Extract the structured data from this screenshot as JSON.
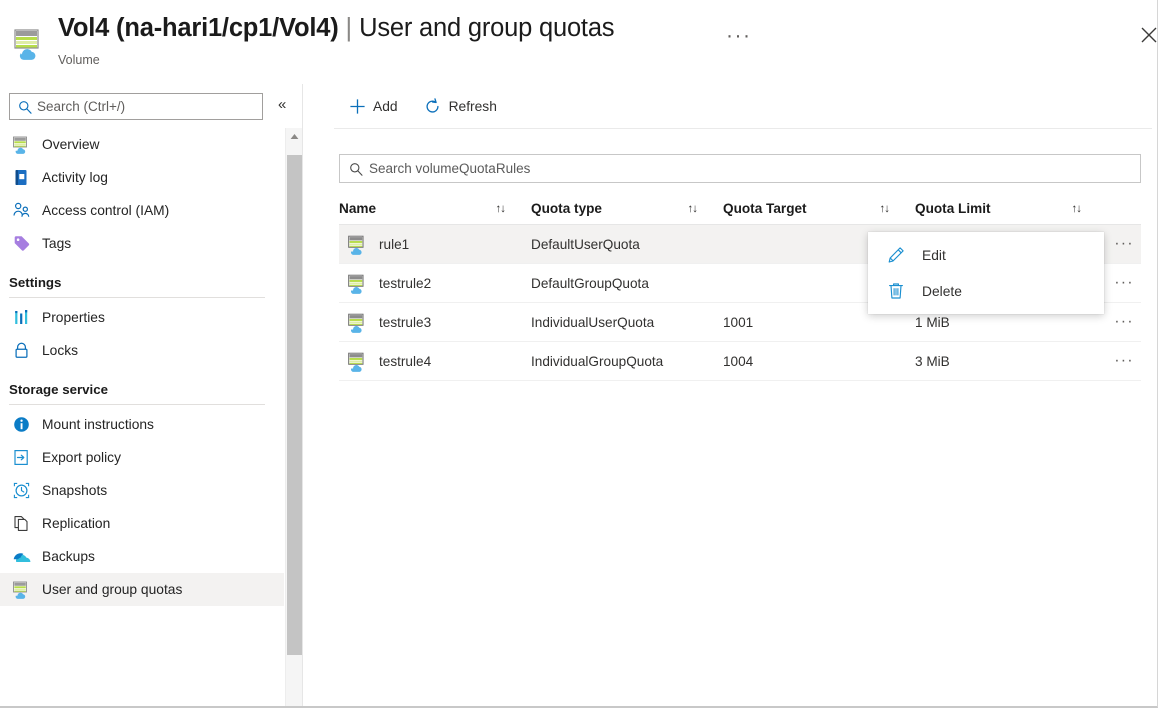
{
  "header": {
    "title_main": "Vol4 (na-hari1/cp1/Vol4)",
    "title_separator": "|",
    "title_sub": "User and group quotas",
    "more_label": "···",
    "resource_type": "Volume",
    "close_label": "Close",
    "icon": "volume-icon"
  },
  "sidebar": {
    "search": {
      "placeholder": "Search (Ctrl+/)",
      "value": "",
      "icon": "search-icon"
    },
    "collapse": {
      "label": "«",
      "icon": "chevron-double-left-icon"
    },
    "items": [
      {
        "label": "Overview",
        "icon": "volume-icon",
        "selected": false
      },
      {
        "label": "Activity log",
        "icon": "activity-log-icon",
        "selected": false
      },
      {
        "label": "Access control (IAM)",
        "icon": "access-control-icon",
        "selected": false
      },
      {
        "label": "Tags",
        "icon": "tag-icon",
        "selected": false
      }
    ],
    "groups": [
      {
        "title": "Settings",
        "items": [
          {
            "label": "Properties",
            "icon": "properties-icon",
            "selected": false
          },
          {
            "label": "Locks",
            "icon": "lock-icon",
            "selected": false
          }
        ]
      },
      {
        "title": "Storage service",
        "items": [
          {
            "label": "Mount instructions",
            "icon": "info-icon",
            "selected": false
          },
          {
            "label": "Export policy",
            "icon": "export-policy-icon",
            "selected": false
          },
          {
            "label": "Snapshots",
            "icon": "snapshot-icon",
            "selected": false
          },
          {
            "label": "Replication",
            "icon": "replication-icon",
            "selected": false
          },
          {
            "label": "Backups",
            "icon": "backup-cloud-icon",
            "selected": false
          },
          {
            "label": "User and group quotas",
            "icon": "volume-icon",
            "selected": true
          }
        ]
      }
    ]
  },
  "toolbar": {
    "add_label": "Add",
    "add_icon": "plus-icon",
    "refresh_label": "Refresh",
    "refresh_icon": "refresh-icon"
  },
  "content_search": {
    "placeholder": "Search volumeQuotaRules",
    "value": "",
    "icon": "search-icon"
  },
  "table": {
    "sort_icon": "↑↓",
    "columns": [
      {
        "key": "name",
        "label": "Name"
      },
      {
        "key": "type",
        "label": "Quota type"
      },
      {
        "key": "target",
        "label": "Quota Target"
      },
      {
        "key": "limit",
        "label": "Quota Limit"
      }
    ],
    "rows": [
      {
        "name": "rule1",
        "type": "DefaultUserQuota",
        "target": "",
        "limit": "",
        "icon": "volume-icon",
        "selected": true,
        "menu_label": "···"
      },
      {
        "name": "testrule2",
        "type": "DefaultGroupQuota",
        "target": "",
        "limit": "",
        "icon": "volume-icon",
        "selected": false,
        "menu_label": "···"
      },
      {
        "name": "testrule3",
        "type": "IndividualUserQuota",
        "target": "1001",
        "limit": "1 MiB",
        "icon": "volume-icon",
        "selected": false,
        "menu_label": "···"
      },
      {
        "name": "testrule4",
        "type": "IndividualGroupQuota",
        "target": "1004",
        "limit": "3 MiB",
        "icon": "volume-icon",
        "selected": false,
        "menu_label": "···"
      }
    ]
  },
  "context_menu": {
    "items": [
      {
        "label": "Edit",
        "icon": "pencil-icon"
      },
      {
        "label": "Delete",
        "icon": "trash-icon"
      }
    ]
  },
  "colors": {
    "accent": "#0078d4",
    "selected_row_bg": "#f3f2f1",
    "text": "#323130",
    "border": "#e6e6e6",
    "icon_green": "#9ad12b",
    "icon_cloud": "#59b4e8",
    "purple": "#8661c5"
  }
}
